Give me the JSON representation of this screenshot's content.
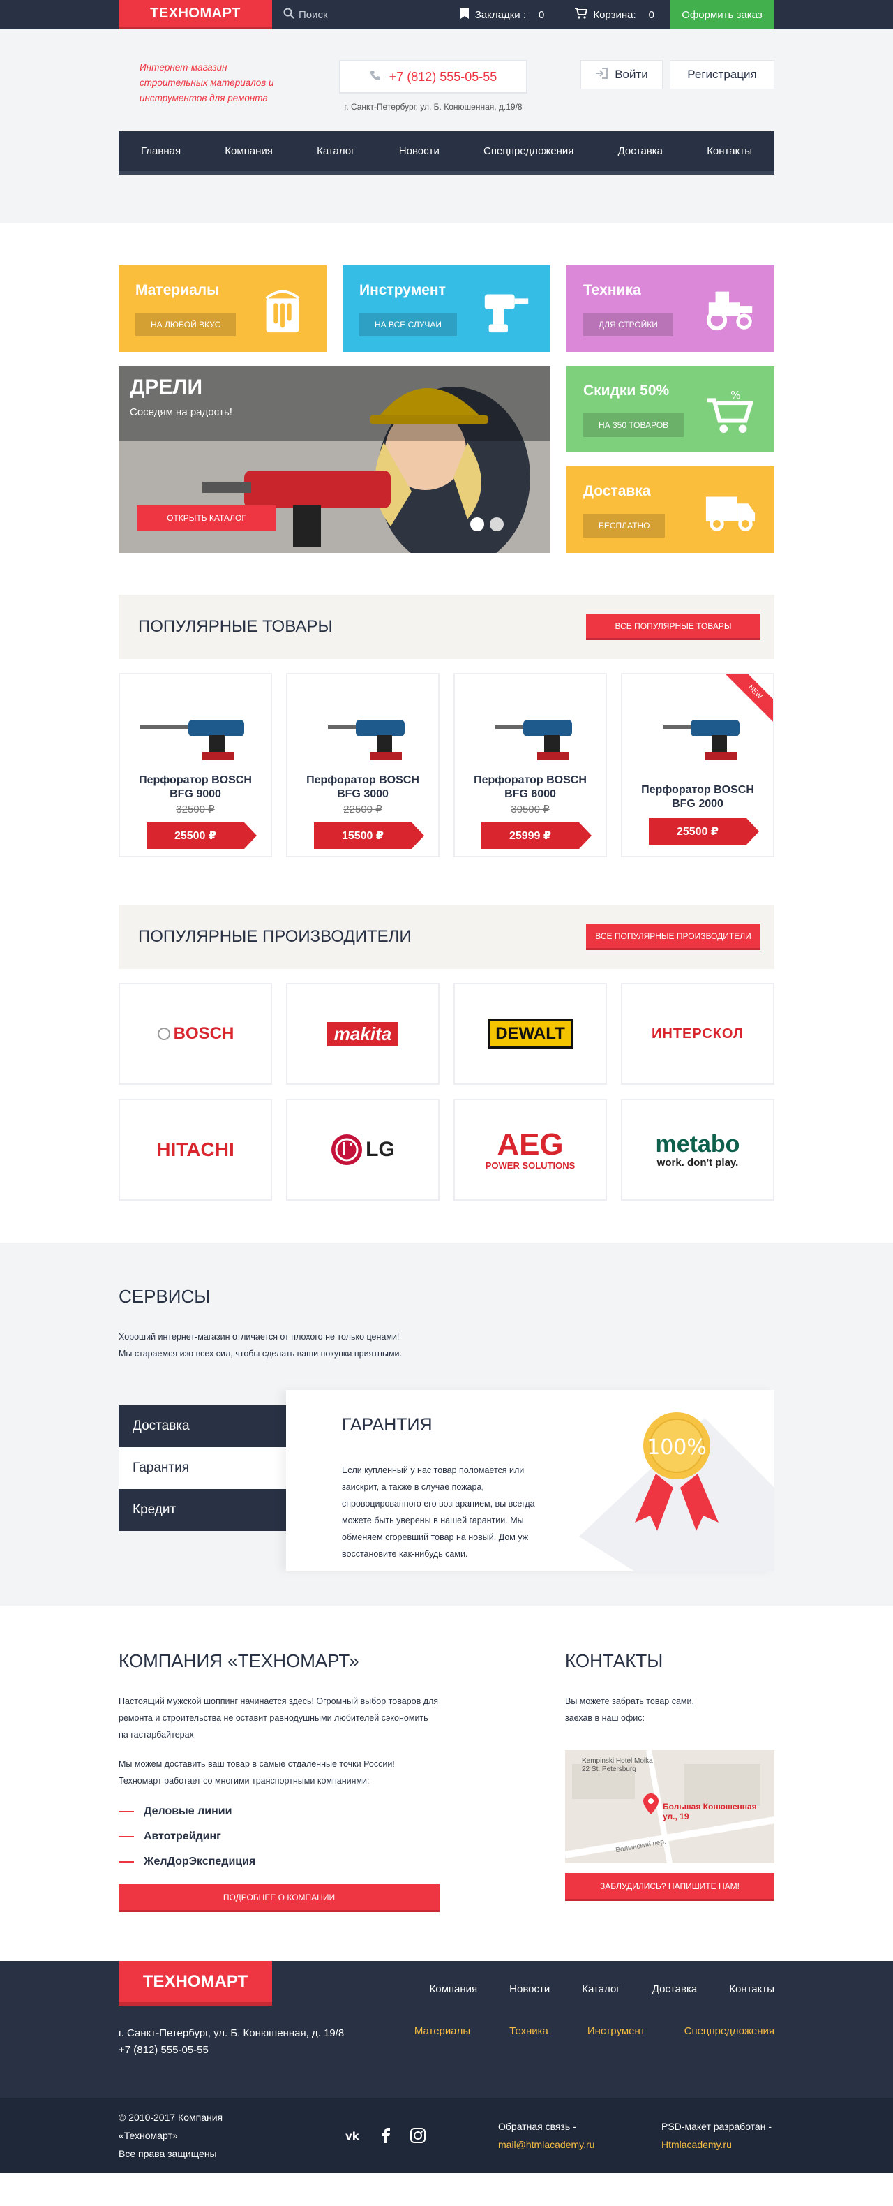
{
  "topbar": {
    "logo": "ТЕХНОМАРТ",
    "search_placeholder": "Поиск",
    "bookmarks_label": "Закладки :",
    "bookmarks_count": "0",
    "cart_label": "Корзина:",
    "cart_count": "0",
    "order_button": "Оформить заказ"
  },
  "header": {
    "slogan": "Интернет-магазин строительных материалов и инструментов для ремонта",
    "phone": "+7 (812) 555-05-55",
    "address": "г. Санкт-Петербург, ул. Б. Конюшенная, д.19/8",
    "login": "Войти",
    "register": "Регистрация"
  },
  "nav": [
    "Главная",
    "Компания",
    "Каталог",
    "Новости",
    "Спецпредложения",
    "Доставка",
    "Контакты"
  ],
  "tiles": [
    {
      "title": "Материалы",
      "button": "На любой вкус",
      "color": "#fbbd3c",
      "icon": "paint-bucket-icon"
    },
    {
      "title": "Инструмент",
      "button": "На все случаи",
      "color": "#35bde6",
      "icon": "drill-icon"
    },
    {
      "title": "Техника",
      "button": "Для стройки",
      "color": "#da88d7",
      "icon": "tractor-icon"
    },
    {
      "title": "Скидки 50%",
      "button": "На 350 товаров",
      "color": "#7ed07d",
      "icon": "cart-icon"
    },
    {
      "title": "Доставка",
      "button": "Бесплатно",
      "color": "#fbbd3c",
      "icon": "truck-icon"
    }
  ],
  "slider": {
    "title": "ДРЕЛИ",
    "subtitle": "Соседям на радость!",
    "button": "Открыть каталог"
  },
  "popular": {
    "title": "Популярные товары",
    "button": "Все популярные товары",
    "products": [
      {
        "name": "Перфоратор BOSCH BFG 9000",
        "old_price": "32500 ₽",
        "price": "25500 ₽"
      },
      {
        "name": "Перфоратор BOSCH BFG 3000",
        "old_price": "22500 ₽",
        "price": "15500 ₽"
      },
      {
        "name": "Перфоратор BOSCH BFG 6000",
        "old_price": "30500 ₽",
        "price": "25999 ₽"
      },
      {
        "name": "Перфоратор BOSCH BFG 2000",
        "old_price": "",
        "price": "25500 ₽",
        "badge": "new"
      }
    ]
  },
  "brands": {
    "title": "Популярные производители",
    "button": "Все популярные производители",
    "items": [
      "BOSCH",
      "makita",
      "DEWALT",
      "ИНТЕРСКОЛ",
      "HITACHI",
      "LG",
      "AEG",
      "metabo"
    ],
    "aeg_sub": "POWER SOLUTIONS",
    "metabo_sub": "work. don't play."
  },
  "services": {
    "title": "СЕРВИСЫ",
    "intro_1": "Хороший интернет-магазин отличается от плохого не только ценами!",
    "intro_2": "Мы стараемся изо всех сил, чтобы сделать ваши покупки приятными.",
    "tabs": [
      "Доставка",
      "Гарантия",
      "Кредит"
    ],
    "active_title": "Гарантия",
    "active_text": "Если купленный у нас товар поломается или заискрит, а также в случае пожара, спровоцированного его возгаранием, вы всегда можете быть уверены в нашей гарантии. Мы обменяем сгоревший товар на новый. Дом уж восстановите как-нибудь сами.",
    "medal": "100%"
  },
  "company": {
    "title": "КОМПАНИЯ «ТЕХНОМАРТ»",
    "p1": "Настоящий мужской шоппинг начинается здесь! Огромный выбор товаров для ремонта и строительства не оставит равнодушными любителей сэкономить на гастарбайтерах",
    "p2a": "Мы можем доставить ваш товар в самые отдаленные точки России!",
    "p2b": "Техномарт работает со многими транспортными компаниями:",
    "carriers": [
      "Деловые линии",
      "Автотрейдинг",
      "ЖелДорЭкспедиция"
    ],
    "button": "Подробнее о компании"
  },
  "contacts": {
    "title": "КОНТАКТЫ",
    "p1": "Вы можете забрать товар сами,",
    "p2": "заехав в наш офис:",
    "map_hotel": "Kempinski Hotel Moika 22 St. Petersburg",
    "map_label": "Большая Конюшенная ул., 19",
    "map_street": "Волынский пер.",
    "button": "Заблудились? Напишите нам!"
  },
  "footer": {
    "logo": "ТЕХНОМАРТ",
    "address": "г. Санкт-Петербург, ул. Б. Конюшенная, д. 19/8",
    "phone": "+7 (812) 555-05-55",
    "nav": [
      "Компания",
      "Новости",
      "Каталог",
      "Доставка",
      "Контакты"
    ],
    "cats": [
      "Материалы",
      "Техника",
      "Инструмент",
      "Спецпредложения"
    ]
  },
  "bottom": {
    "copy1": "© 2010-2017 Компания «Техномарт»",
    "copy2": "Все права защищены",
    "feedback_label": "Обратная связь -",
    "feedback_email": "mail@htmlacademy.ru",
    "psd_label": "PSD-макет разработан -",
    "psd_link": "Htmlacademy.ru",
    "socials": [
      "vk-icon",
      "facebook-icon",
      "instagram-icon"
    ]
  }
}
